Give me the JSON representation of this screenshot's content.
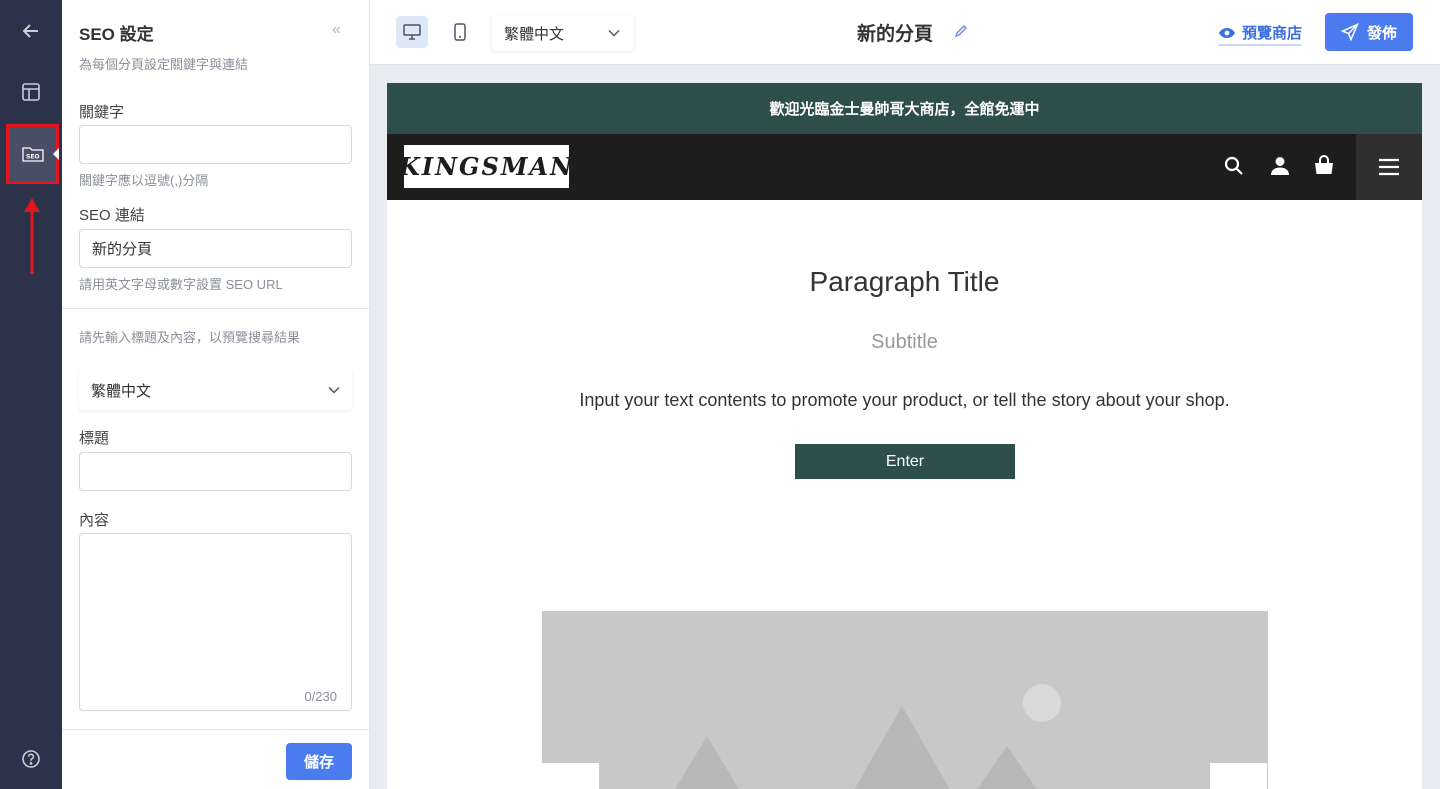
{
  "rail": {
    "items": [
      {
        "name": "back",
        "icon": "arrow-left-icon"
      },
      {
        "name": "layout",
        "icon": "layout-icon"
      },
      {
        "name": "seo",
        "icon": "seo-icon",
        "active": true
      },
      {
        "name": "help",
        "icon": "help-icon"
      }
    ]
  },
  "panel": {
    "title": "SEO 設定",
    "subtitle": "為每個分頁設定關鍵字與連結",
    "keywords_label": "關鍵字",
    "keywords_value": "",
    "keywords_hint": "關鍵字應以逗號(,)分隔",
    "seo_link_label": "SEO 連結",
    "seo_link_value": "新的分頁",
    "seo_link_hint": "請用英文字母或數字設置 SEO URL",
    "preview_hint": "請先輸入標題及內容，以預覽搜尋結果",
    "language_select": "繁體中文",
    "title_label": "標題",
    "title_value": "",
    "content_label": "內容",
    "content_value": "",
    "content_counter": "0/230",
    "save_label": "儲存"
  },
  "topbar": {
    "language": "繁體中文",
    "page_name": "新的分頁",
    "preview_label": "預覽商店",
    "publish_label": "發佈",
    "accent_color": "#4a7cf0"
  },
  "preview": {
    "announcement": "歡迎光臨金士曼帥哥大商店，全館免運中",
    "logo_text": "KINGSMAN",
    "paragraph_title": "Paragraph Title",
    "subtitle": "Subtitle",
    "body": "Input your text contents to promote your product, or tell the story about your shop.",
    "button_label": "Enter",
    "brand_color": "#2e4e49"
  }
}
